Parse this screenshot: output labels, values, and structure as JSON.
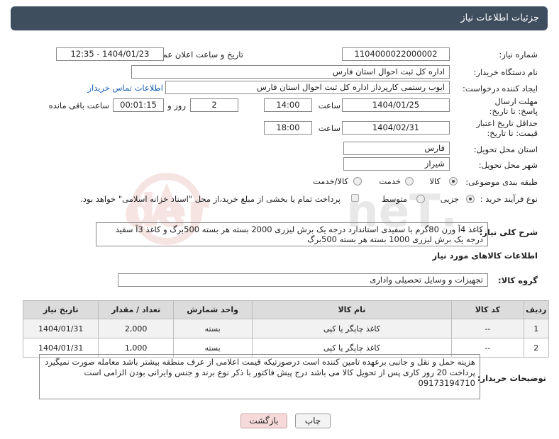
{
  "page_title": "جزئیات اطلاعات نیاز",
  "labels": {
    "need_number": "شماره نیاز:",
    "announce_datetime": "تاریخ و ساعت اعلان عمومی:",
    "buyer_org": "نام دستگاه خریدار:",
    "requester": "ایجاد کننده درخواست:",
    "contact_link": "اطلاعات تماس خریدار",
    "send_deadline": "مهلت ارسال پاسخ: تا تاریخ:",
    "time": "ساعت",
    "day_and": "روز و",
    "remaining": "ساعت باقی مانده",
    "validity": "حداقل تاریخ اعتبار قیمت: تا تاریخ:",
    "time2": "ساعت",
    "province": "استان محل تحویل:",
    "city": "شهر محل تحویل:",
    "category": "طبقه بندی موضوعی:",
    "process": "نوع فرآیند خرید :",
    "description": "شرح کلی نیاز:",
    "goods_info": "اطلاعات کالاهای مورد نیاز",
    "goods_group": "گروه کالا:",
    "buyer_notes": "توضیحات خریدار:"
  },
  "values": {
    "need_number": "1104000022000002",
    "announce_datetime": "1404/01/23 - 12:35",
    "buyer_org": "اداره کل ثبت احوال استان فارس",
    "requester": "ایوب رستمی کارپرداز اداره کل ثبت احوال استان فارس",
    "deadline_date": "1404/01/25",
    "deadline_time": "14:00",
    "days": "2",
    "remaining_time": "00:01:15",
    "validity_date": "1404/02/31",
    "validity_time": "18:00",
    "province": "فارس",
    "city": "شیراز",
    "description": "کاغذ 4آ ورن 80گرم با سفیدی استاندارد درجه یک برش لیزری 2000 بسته هر بسته 500برگ و کاغذ 3آ سفید درجه یک برش لیزری 1000 بسته هر بسته 500برگ",
    "goods_group": "تجهیزات و وسایل تحصیلی واداری",
    "buyer_notes": "هزینه حمل و نقل و جانبی برعهده تامین کننده است درصورتیکه قیمت اعلامی از عرف منطقه بیشتر باشد معامله صورت نمیگیرد پرداخت 20 روز کاری پس از تحویل کالا می باشد درج پیش فاکتور با ذکر نوع برند و جنس وایرانی بودن الزامی است 09173194710"
  },
  "category_options": [
    {
      "label": "کالا",
      "selected": true
    },
    {
      "label": "خدمت",
      "selected": false
    },
    {
      "label": "کالا/خدمت",
      "selected": false
    }
  ],
  "process_options": [
    {
      "label": "جزیی",
      "selected": true
    },
    {
      "label": "متوسط",
      "selected": false
    }
  ],
  "process_note": "پرداخت تمام یا بخشی از مبلغ خرید،از محل \"اسناد خزانه اسلامی\" خواهد بود.",
  "table": {
    "headers": [
      "ردیف",
      "کد کالا",
      "نام کالا",
      "واحد شمارش",
      "تعداد / مقدار",
      "تاریخ نیاز"
    ],
    "rows": [
      [
        "1",
        "--",
        "کاغذ چاپگر یا کپی",
        "بسته",
        "2,000",
        "1404/01/31"
      ],
      [
        "2",
        "--",
        "کاغذ چاپگر یا کپی",
        "بسته",
        "1,000",
        "1404/01/31"
      ]
    ]
  },
  "buttons": {
    "print": "چاپ",
    "back": "بازگشت"
  },
  "colors": {
    "title_bg": "#3f4e5e",
    "back_button_bg": "#f6dada",
    "link": "#1a5fb4"
  }
}
